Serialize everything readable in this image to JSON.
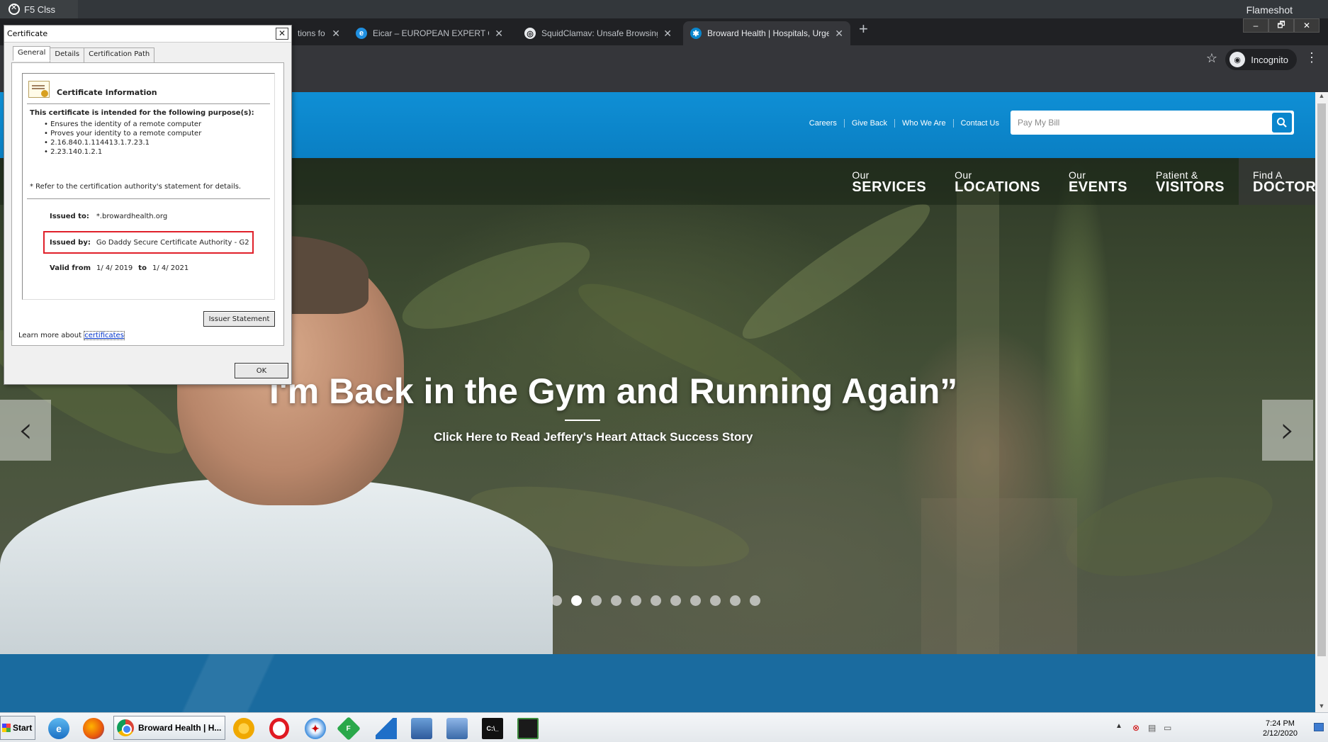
{
  "window": {
    "top_left_tab": "F5 Clss",
    "flameshot_label": "Flameshot",
    "controls": [
      "–",
      "🗗",
      "✕"
    ]
  },
  "browser": {
    "tabs": [
      {
        "label": "tions fo",
        "icon": "",
        "active": false
      },
      {
        "label": "Eicar – EUROPEAN EXPERT GROU",
        "icon": "ie-icon",
        "active": false
      },
      {
        "label": "SquidClamav: Unsafe Browsing d",
        "icon": "globe-icon",
        "active": false
      },
      {
        "label": "Broward Health | Hospitals, Urge",
        "icon": "broward-logo-icon",
        "active": true
      }
    ],
    "new_tab_symbol": "+",
    "incognito_label": "Incognito"
  },
  "site": {
    "top_links": [
      "Careers",
      "Give Back",
      "Who We Are",
      "Contact Us"
    ],
    "search_placeholder": "Pay My Bill",
    "nav": [
      {
        "small": "Our",
        "big": "SERVICES"
      },
      {
        "small": "Our",
        "big": "LOCATIONS"
      },
      {
        "small": "Our",
        "big": "EVENTS"
      },
      {
        "small": "Patient &",
        "big": "VISITORS"
      },
      {
        "small": "Find A",
        "big": "DOCTOR"
      }
    ],
    "hero_title": "I'm Back in the Gym and Running Again”",
    "hero_subtitle": "Click Here to Read Jeffery's Heart Attack Success Story",
    "prev_arrow": "‹",
    "next_arrow": "›",
    "carousel": {
      "count": 11,
      "active_index": 1
    }
  },
  "certificate_dialog": {
    "title": "Certificate",
    "close_symbol": "✕",
    "tabs": [
      "General",
      "Details",
      "Certification Path"
    ],
    "heading": "Certificate Information",
    "purpose_title": "This certificate is intended for the following purpose(s):",
    "purposes": [
      "Ensures the identity of a remote computer",
      "Proves your identity to a remote computer",
      "2.16.840.1.114413.1.7.23.1",
      "2.23.140.1.2.1"
    ],
    "refer_note": "* Refer to the certification authority's statement for details.",
    "issued_to_label": "Issued to:",
    "issued_to_value": "*.browardhealth.org",
    "issued_by_label": "Issued by:",
    "issued_by_value": "Go Daddy Secure Certificate Authority - G2",
    "valid_from_label": "Valid from",
    "valid_from_value": "1/ 4/ 2019",
    "valid_to_label": "to",
    "valid_to_value": "1/ 4/ 2021",
    "issuer_statement_button": "Issuer Statement",
    "learn_more_prefix": "Learn more about ",
    "learn_more_link": "certificates",
    "ok_button": "OK"
  },
  "taskbar": {
    "start_label": "Start",
    "active_task_label": "Broward Health | H...",
    "clock_time": "7:24 PM",
    "clock_date": "2/12/2020"
  },
  "colors": {
    "site_header_blue": "#0a86cd",
    "highlight_red": "#e0202a",
    "chrome_dark": "#35363a"
  }
}
